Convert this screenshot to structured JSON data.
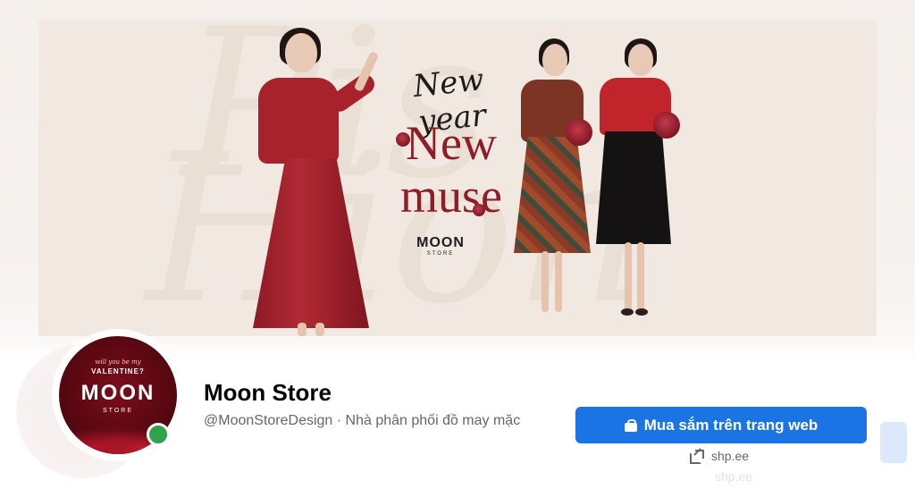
{
  "cover": {
    "script_text": "New year",
    "headline_line1": "New",
    "headline_line2": "muse",
    "logo_name": "MOON",
    "logo_sub": "STORE"
  },
  "avatar": {
    "tiny_text": "will you be my",
    "tagline": "VALENTINE?",
    "brand": "MOON",
    "brand_sub": "STORE"
  },
  "profile": {
    "name": "Moon Store",
    "handle_and_category": "@MoonStoreDesign · Nhà phân phối đồ may mặc",
    "online": true
  },
  "actions": {
    "shop_button_label": "Mua sắm trên trang web",
    "shop_icon": "shopping-bag-icon",
    "website_link": "shp.ee",
    "website_icon": "external-link-icon"
  },
  "ghost": {
    "link_text": "shp.ee"
  },
  "colors": {
    "accent": "#1b74e4",
    "brand_red": "#8f1d25",
    "online": "#31a24c",
    "secondary_text": "#65676b"
  }
}
